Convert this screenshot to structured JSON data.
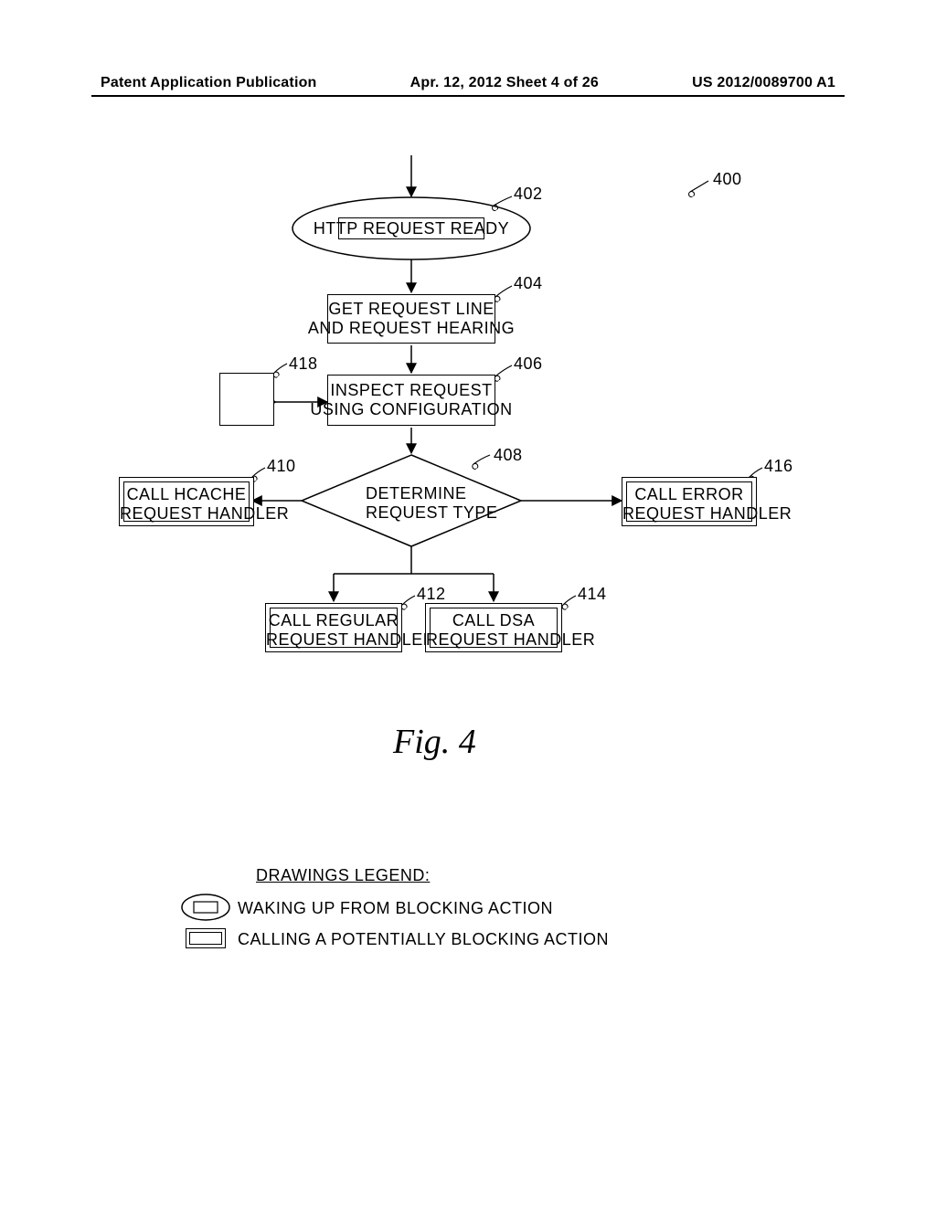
{
  "header": {
    "left": "Patent Application Publication",
    "center": "Apr. 12, 2012  Sheet 4 of 26",
    "right": "US 2012/0089700 A1"
  },
  "ref": {
    "r400": "400",
    "r402": "402",
    "r404": "404",
    "r406": "406",
    "r408": "408",
    "r410": "410",
    "r412": "412",
    "r414": "414",
    "r416": "416",
    "r418": "418"
  },
  "nodes": {
    "n402": "HTTP REQUEST READY",
    "n404": "GET REQUEST LINE\nAND REQUEST HEARING",
    "n406": "INSPECT REQUEST\nUSING CONFIGURATION",
    "n408": "DETERMINE\nREQUEST TYPE",
    "n410": "CALL HCACHE\nREQUEST HANDLER",
    "n412": "CALL REGULAR\nREQUEST HANDLER",
    "n414": "CALL DSA\nREQUEST HANDLER",
    "n416": "CALL ERROR\nREQUEST HANDLER"
  },
  "legend": {
    "title": "DRAWINGS LEGEND:",
    "item1": "WAKING UP FROM BLOCKING ACTION",
    "item2": "CALLING A POTENTIALLY BLOCKING ACTION"
  },
  "figure_caption": "Fig. 4"
}
